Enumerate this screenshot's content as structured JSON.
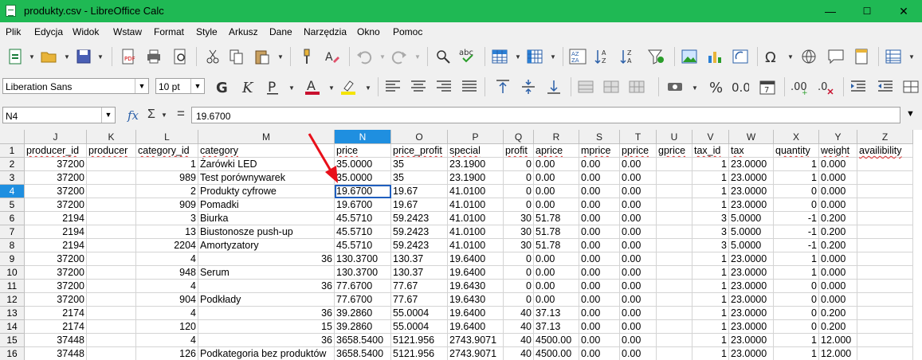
{
  "window": {
    "title": "produkty.csv - LibreOffice Calc",
    "minimize": "—",
    "maximize": "☐",
    "close": "✕"
  },
  "menu": [
    "Plik",
    "Edycja",
    "Widok",
    "Wstaw",
    "Format",
    "Style",
    "Arkusz",
    "Dane",
    "Narzędzia",
    "Okno",
    "Pomoc"
  ],
  "toolbar": {
    "font_name": "Liberation Sans",
    "font_size": "10 pt"
  },
  "formula_bar": {
    "name_box": "N4",
    "content": "19.6700",
    "fx": "fx",
    "sum": "Σ",
    "equals": "="
  },
  "columns": [
    "J",
    "K",
    "L",
    "M",
    "N",
    "O",
    "P",
    "Q",
    "R",
    "S",
    "T",
    "U",
    "V",
    "W",
    "X",
    "Y",
    "Z"
  ],
  "selected_column": "N",
  "selected_row": 4,
  "rows": [
    {
      "n": "1",
      "c": [
        "producer_id",
        "producer",
        "category_id",
        "category",
        "price",
        "price_profit",
        "special",
        "profit",
        "aprice",
        "mprice",
        "pprice",
        "gprice",
        "tax_id",
        "tax",
        "quantity",
        "weight",
        "availibility"
      ]
    },
    {
      "n": "2",
      "c": [
        "37200",
        "",
        "1",
        "Żarówki LED",
        "35.0000",
        "35",
        "23.1900",
        "0",
        "0.00",
        "0.00",
        "0.00",
        "",
        "1",
        "23.0000",
        "1",
        "0.000",
        ""
      ]
    },
    {
      "n": "3",
      "c": [
        "37200",
        "",
        "989",
        "Test porównywarek",
        "35.0000",
        "35",
        "23.1900",
        "0",
        "0.00",
        "0.00",
        "0.00",
        "",
        "1",
        "23.0000",
        "1",
        "0.000",
        ""
      ]
    },
    {
      "n": "4",
      "c": [
        "37200",
        "",
        "2",
        "Produkty cyfrowe",
        "19.6700",
        "19.67",
        "41.0100",
        "0",
        "0.00",
        "0.00",
        "0.00",
        "",
        "1",
        "23.0000",
        "0",
        "0.000",
        ""
      ]
    },
    {
      "n": "5",
      "c": [
        "37200",
        "",
        "909",
        "Pomadki",
        "19.6700",
        "19.67",
        "41.0100",
        "0",
        "0.00",
        "0.00",
        "0.00",
        "",
        "1",
        "23.0000",
        "0",
        "0.000",
        ""
      ]
    },
    {
      "n": "6",
      "c": [
        "2194",
        "",
        "3",
        "Biurka",
        "45.5710",
        "59.2423",
        "41.0100",
        "30",
        "51.78",
        "0.00",
        "0.00",
        "",
        "3",
        "5.0000",
        "-1",
        "0.200",
        ""
      ]
    },
    {
      "n": "7",
      "c": [
        "2194",
        "",
        "13",
        "Biustonosze push-up",
        "45.5710",
        "59.2423",
        "41.0100",
        "30",
        "51.78",
        "0.00",
        "0.00",
        "",
        "3",
        "5.0000",
        "-1",
        "0.200",
        ""
      ]
    },
    {
      "n": "8",
      "c": [
        "2194",
        "",
        "2204",
        "Amortyzatory",
        "45.5710",
        "59.2423",
        "41.0100",
        "30",
        "51.78",
        "0.00",
        "0.00",
        "",
        "3",
        "5.0000",
        "-1",
        "0.200",
        ""
      ]
    },
    {
      "n": "9",
      "c": [
        "37200",
        "",
        "4",
        "36",
        "130.3700",
        "130.37",
        "19.6400",
        "0",
        "0.00",
        "0.00",
        "0.00",
        "",
        "1",
        "23.0000",
        "1",
        "0.000",
        ""
      ]
    },
    {
      "n": "10",
      "c": [
        "37200",
        "",
        "948",
        "Serum",
        "130.3700",
        "130.37",
        "19.6400",
        "0",
        "0.00",
        "0.00",
        "0.00",
        "",
        "1",
        "23.0000",
        "1",
        "0.000",
        ""
      ]
    },
    {
      "n": "11",
      "c": [
        "37200",
        "",
        "4",
        "36",
        "77.6700",
        "77.67",
        "19.6430",
        "0",
        "0.00",
        "0.00",
        "0.00",
        "",
        "1",
        "23.0000",
        "0",
        "0.000",
        ""
      ]
    },
    {
      "n": "12",
      "c": [
        "37200",
        "",
        "904",
        "Podkłady",
        "77.6700",
        "77.67",
        "19.6430",
        "0",
        "0.00",
        "0.00",
        "0.00",
        "",
        "1",
        "23.0000",
        "0",
        "0.000",
        ""
      ]
    },
    {
      "n": "13",
      "c": [
        "2174",
        "",
        "4",
        "36",
        "39.2860",
        "55.0004",
        "19.6400",
        "40",
        "37.13",
        "0.00",
        "0.00",
        "",
        "1",
        "23.0000",
        "0",
        "0.200",
        ""
      ]
    },
    {
      "n": "14",
      "c": [
        "2174",
        "",
        "120",
        "15",
        "39.2860",
        "55.0004",
        "19.6400",
        "40",
        "37.13",
        "0.00",
        "0.00",
        "",
        "1",
        "23.0000",
        "0",
        "0.200",
        ""
      ]
    },
    {
      "n": "15",
      "c": [
        "37448",
        "",
        "4",
        "36",
        "3658.5400",
        "5121.956",
        "2743.9071",
        "40",
        "4500.00",
        "0.00",
        "0.00",
        "",
        "1",
        "23.0000",
        "1",
        "12.000",
        ""
      ]
    },
    {
      "n": "16",
      "c": [
        "37448",
        "",
        "126",
        "Podkategoria bez produktów",
        "3658.5400",
        "5121.956",
        "2743.9071",
        "40",
        "4500.00",
        "0.00",
        "0.00",
        "",
        "1",
        "23.0000",
        "1",
        "12.000",
        ""
      ]
    }
  ]
}
